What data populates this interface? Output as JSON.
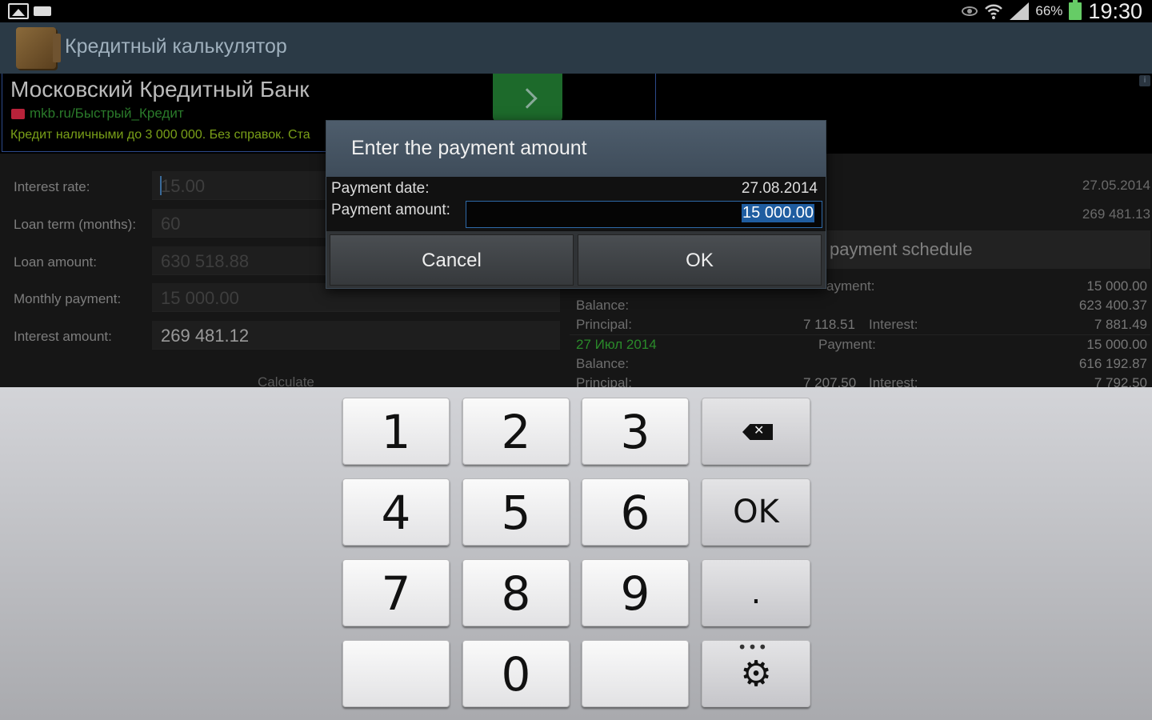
{
  "status_bar": {
    "battery_percent": "66%",
    "clock": "19:30"
  },
  "action_bar": {
    "title": "Кредитный калькулятор"
  },
  "ad": {
    "title": "Московский Кредитный Банк",
    "url": "mkb.ru/Быстрый_Кредит",
    "description": "Кредит наличными до 3 000 000. Без справок. Ста"
  },
  "form": {
    "interest_rate_label": "Interest rate:",
    "interest_rate_value": "15.00",
    "loan_term_label": "Loan term (months):",
    "loan_term_value": "60",
    "loan_amount_label": "Loan amount:",
    "loan_amount_value": "630 518.88",
    "monthly_payment_label": "Monthly payment:",
    "monthly_payment_value": "15 000.00",
    "interest_amount_label": "Interest amount:",
    "interest_amount_value": "269 481.12",
    "calculate_label": "Calculate"
  },
  "right_panel": {
    "date_value": "27.05.2014",
    "interest_value": "269 481.13",
    "schedule_title": "payment schedule",
    "rows": [
      {
        "payment_label": "ayment:",
        "payment_value": "15 000.00",
        "balance_value": "623 400.37"
      },
      {
        "balance_label": "Balance:",
        "principal_label": "Principal:",
        "principal_value": "7 118.51",
        "interest_label": "Interest:",
        "interest_value": "7 881.49"
      },
      {
        "date": "27 Июл 2014",
        "payment_label": "Payment:",
        "payment_value": "15 000.00",
        "balance_label": "Balance:",
        "balance_value": "616 192.87"
      },
      {
        "principal_label": "Principal:",
        "principal_value": "7 207.50",
        "interest_label": "Interest:",
        "interest_value": "7 792.50"
      }
    ]
  },
  "dialog": {
    "title": "Enter the payment amount",
    "payment_date_label": "Payment date:",
    "payment_date_value": "27.08.2014",
    "payment_amount_label": "Payment amount:",
    "payment_amount_value": "15 000.00",
    "cancel_label": "Cancel",
    "ok_label": "OK"
  },
  "keyboard": {
    "keys": [
      "1",
      "2",
      "3",
      "4",
      "5",
      "6",
      "7",
      "8",
      "9",
      "0"
    ],
    "ok_label": "OK",
    "dot_label": "."
  }
}
